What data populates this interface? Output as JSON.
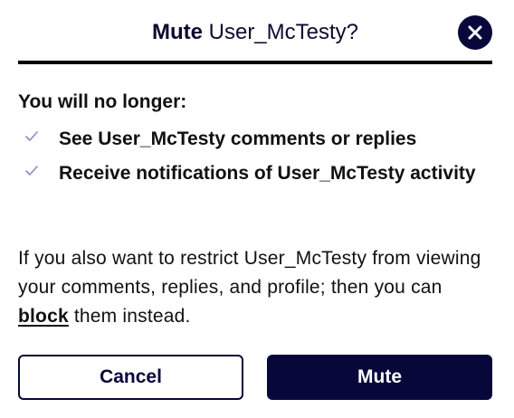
{
  "dialog": {
    "title_strong": "Mute",
    "title_rest": " User_McTesty?",
    "close_icon": "close-icon"
  },
  "body": {
    "lead": "You will no longer:",
    "items": [
      {
        "icon": "check-icon",
        "label": "See User_McTesty comments or replies"
      },
      {
        "icon": "check-icon",
        "label": "Receive notifications of User_McTesty activity"
      }
    ],
    "paragraph_before": "If you also want to restrict User_McTesty from viewing your comments, replies, and profile; then you can ",
    "paragraph_link": "block",
    "paragraph_after": " them instead."
  },
  "actions": {
    "cancel_label": "Cancel",
    "mute_label": "Mute"
  },
  "colors": {
    "primary": "#07073a",
    "check": "#8a8fb8"
  }
}
